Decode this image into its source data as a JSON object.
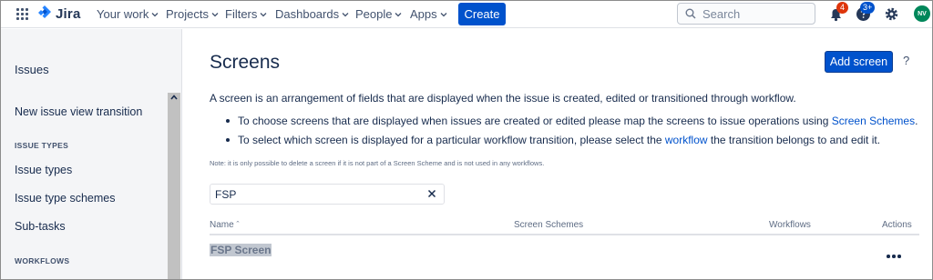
{
  "nav": {
    "app_name": "Jira",
    "items": [
      {
        "label": "Your work"
      },
      {
        "label": "Projects"
      },
      {
        "label": "Filters"
      },
      {
        "label": "Dashboards"
      },
      {
        "label": "People"
      },
      {
        "label": "Apps"
      }
    ],
    "create_label": "Create",
    "search_placeholder": "Search",
    "notifications_count": "4",
    "help_count": "3+",
    "avatar_initials": "NV",
    "colors": {
      "primary": "#0052cc",
      "badge_red": "#de350b",
      "badge_blue": "#0052cc",
      "avatar": "#00875a"
    }
  },
  "sidebar": {
    "section_title": "Issues",
    "item_transition": "New issue view transition",
    "group_issue_types": "ISSUE TYPES",
    "issue_type_items": [
      {
        "label": "Issue types"
      },
      {
        "label": "Issue type schemes"
      },
      {
        "label": "Sub-tasks"
      }
    ],
    "group_workflows": "WORKFLOWS"
  },
  "main": {
    "title": "Screens",
    "add_button": "Add screen",
    "help_label": "?",
    "description": "A screen is an arrangement of fields that are displayed when the issue is created, edited or transitioned through workflow.",
    "bullet1_text": "To choose screens that are displayed when issues are created or edited please map the screens to issue operations using ",
    "bullet1_link": "Screen Schemes",
    "bullet1_end": ".",
    "bullet2_text": "To select which screen is displayed for a particular workflow transition, please select the ",
    "bullet2_link": "workflow",
    "bullet2_end": " the transition belongs to and edit it.",
    "note": "Note: it is only possible to delete a screen if it is not part of a Screen Scheme and is not used in any workflows.",
    "filter_value": "FSP",
    "table": {
      "headers": {
        "name": "Name",
        "sort_indicator": "ˆ",
        "screen_schemes": "Screen Schemes",
        "workflows": "Workflows",
        "actions": "Actions"
      },
      "rows": [
        {
          "name": "FSP Screen",
          "actions_label": "more-actions"
        }
      ]
    }
  }
}
